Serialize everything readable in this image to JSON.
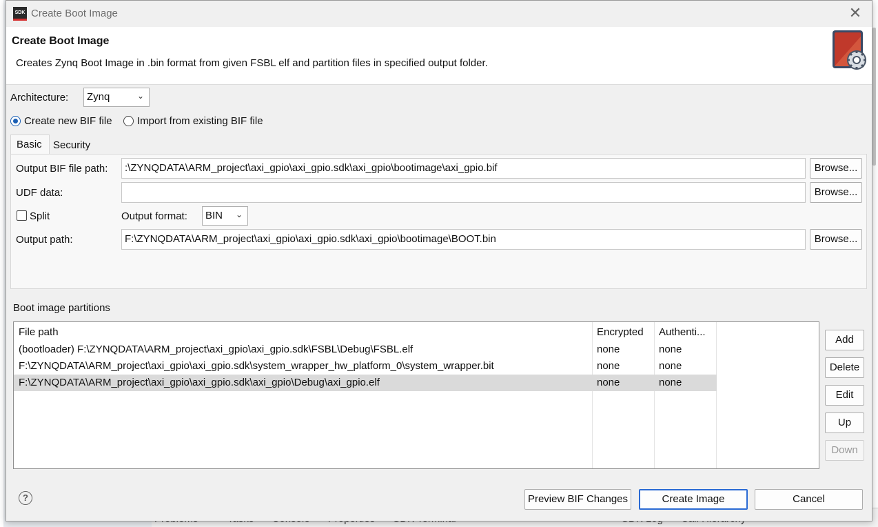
{
  "window": {
    "app_icon": "SDK",
    "title": "Create Boot Image",
    "close": "✕"
  },
  "header": {
    "title": "Create Boot Image",
    "description": "Creates Zynq Boot Image in .bin format from given FSBL elf and partition files in specified output folder.",
    "icon": "boot-image-gear-icon"
  },
  "architecture": {
    "label": "Architecture:",
    "value": "Zynq"
  },
  "bif_mode": {
    "create_label": "Create new BIF file",
    "import_label": "Import from existing BIF file",
    "selected": "create"
  },
  "tabs": [
    {
      "label": "Basic",
      "active": true
    },
    {
      "label": "Security",
      "active": false
    }
  ],
  "basic": {
    "bif_path_label": "Output BIF file path:",
    "bif_path_value": ":\\ZYNQDATA\\ARM_project\\axi_gpio\\axi_gpio.sdk\\axi_gpio\\bootimage\\axi_gpio.bif",
    "udf_label": "UDF data:",
    "udf_value": "",
    "split_label": "Split",
    "split_checked": false,
    "format_label": "Output format:",
    "format_value": "BIN",
    "output_path_label": "Output path:",
    "output_path_value": "F:\\ZYNQDATA\\ARM_project\\axi_gpio\\axi_gpio.sdk\\axi_gpio\\bootimage\\BOOT.bin",
    "browse_label": "Browse..."
  },
  "partitions": {
    "section_label": "Boot image partitions",
    "columns": [
      "File path",
      "Encrypted",
      "Authenti..."
    ],
    "rows": [
      {
        "path": "(bootloader) F:\\ZYNQDATA\\ARM_project\\axi_gpio\\axi_gpio.sdk\\FSBL\\Debug\\FSBL.elf",
        "encrypted": "none",
        "auth": "none"
      },
      {
        "path": "F:\\ZYNQDATA\\ARM_project\\axi_gpio\\axi_gpio.sdk\\system_wrapper_hw_platform_0\\system_wrapper.bit",
        "encrypted": "none",
        "auth": "none"
      },
      {
        "path": "F:\\ZYNQDATA\\ARM_project\\axi_gpio\\axi_gpio.sdk\\axi_gpio\\Debug\\axi_gpio.elf",
        "encrypted": "none",
        "auth": "none"
      }
    ],
    "selected_row": 2,
    "buttons": {
      "add": "Add",
      "delete": "Delete",
      "edit": "Edit",
      "up": "Up",
      "down": "Down"
    }
  },
  "footer": {
    "help": "?",
    "preview": "Preview BIF Changes",
    "create": "Create Image",
    "cancel": "Cancel"
  },
  "background_tabs": [
    "Problems ✕",
    "Tasks",
    "Console",
    "Properties",
    "SDK Terminal",
    "SDK Log",
    "Call Hierarchy ✕"
  ],
  "colors": {
    "accent": "#1a5fb4",
    "selected_row": "#dadada",
    "primary_border": "#2a6ad4"
  }
}
